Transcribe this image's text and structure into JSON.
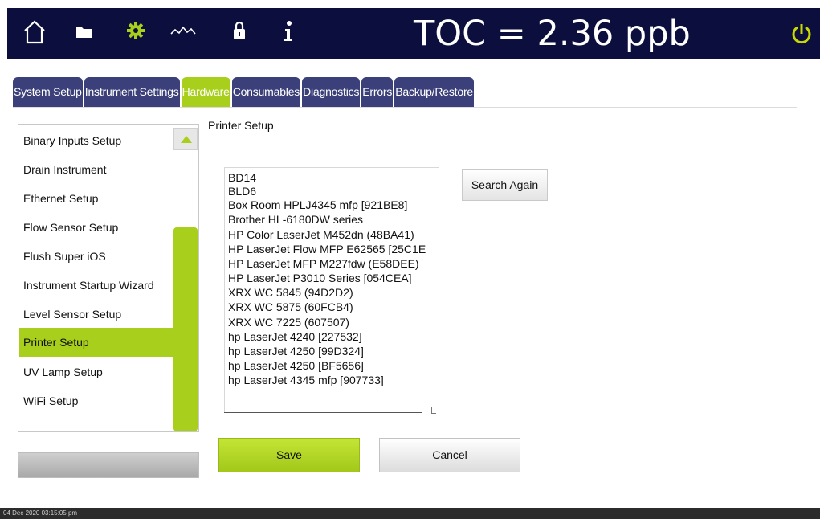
{
  "header": {
    "toc_readout": "TOC = 2.36 ppb",
    "icons": [
      "home-icon",
      "folder-icon",
      "gear-icon",
      "trend-icon",
      "lock-icon",
      "info-icon",
      "power-icon"
    ],
    "accent_color": "#a8cf1c",
    "bar_color": "#0c0f3d"
  },
  "tabs": [
    {
      "label": "System Setup",
      "active": false
    },
    {
      "label": "Instrument Settings",
      "active": false
    },
    {
      "label": "Hardware",
      "active": true
    },
    {
      "label": "Consumables",
      "active": false
    },
    {
      "label": "Diagnostics",
      "active": false
    },
    {
      "label": "Errors",
      "active": false
    },
    {
      "label": "Backup/Restore",
      "active": false
    }
  ],
  "sidebar": {
    "items": [
      {
        "label": "Binary Inputs Setup"
      },
      {
        "label": "Drain Instrument"
      },
      {
        "label": "Ethernet Setup"
      },
      {
        "label": "Flow Sensor Setup"
      },
      {
        "label": "Flush Super iOS"
      },
      {
        "label": "Instrument Startup Wizard"
      },
      {
        "label": "Level Sensor Setup"
      },
      {
        "label": "Printer Setup",
        "selected": true
      },
      {
        "label": "UV Lamp Setup"
      },
      {
        "label": "WiFi Setup"
      }
    ]
  },
  "printer_setup": {
    "title": "Printer Setup",
    "printers": [
      "BD14",
      "BLD6",
      "Box Room HPLJ4345 mfp [921BE8]",
      "Brother HL-6180DW series",
      "HP Color LaserJet M452dn (48BA41)",
      "HP LaserJet Flow MFP E62565 [25C1E",
      "HP LaserJet MFP M227fdw (E58DEE)",
      "HP LaserJet P3010 Series [054CEA]",
      "XRX WC 5845 (94D2D2)",
      "XRX WC 5875 (60FCB4)",
      "XRX WC 7225 (607507)",
      "hp LaserJet 4240 [227532]",
      "hp LaserJet 4250 [99D324]",
      "hp LaserJet 4250 [BF5656]",
      "hp LaserJet 4345 mfp [907733]"
    ],
    "search_again_label": "Search Again",
    "save_label": "Save",
    "cancel_label": "Cancel"
  },
  "status_bar": {
    "datetime": "04 Dec 2020 03:15:05 pm"
  }
}
